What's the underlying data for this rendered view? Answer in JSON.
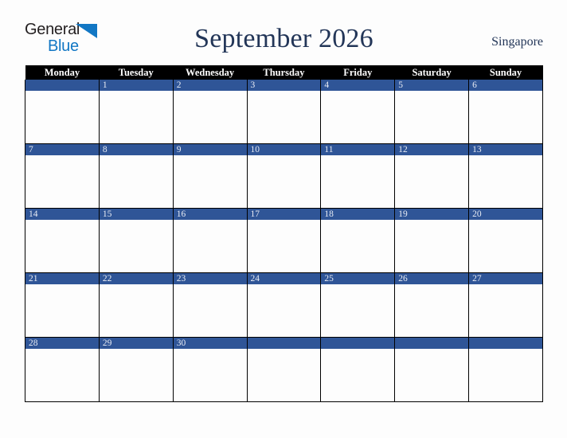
{
  "brand": {
    "name_part1": "General",
    "name_part2": "Blue",
    "triangle_color": "#1277c4",
    "text_color": "#231f20"
  },
  "header": {
    "title": "September 2026",
    "region": "Singapore",
    "title_color": "#233658"
  },
  "calendar": {
    "weekday_headers": [
      "Monday",
      "Tuesday",
      "Wednesday",
      "Thursday",
      "Friday",
      "Saturday",
      "Sunday"
    ],
    "header_bg": "#000000",
    "header_text": "#ffffff",
    "day_bar_color": "#2f5597",
    "day_number_color": "#e8ecf4",
    "cell_bg": "#fdfdfd",
    "grid_line_color": "#000000",
    "weeks": [
      [
        "",
        "1",
        "2",
        "3",
        "4",
        "5",
        "6"
      ],
      [
        "7",
        "8",
        "9",
        "10",
        "11",
        "12",
        "13"
      ],
      [
        "14",
        "15",
        "16",
        "17",
        "18",
        "19",
        "20"
      ],
      [
        "21",
        "22",
        "23",
        "24",
        "25",
        "26",
        "27"
      ],
      [
        "28",
        "29",
        "30",
        "",
        "",
        "",
        ""
      ]
    ]
  }
}
